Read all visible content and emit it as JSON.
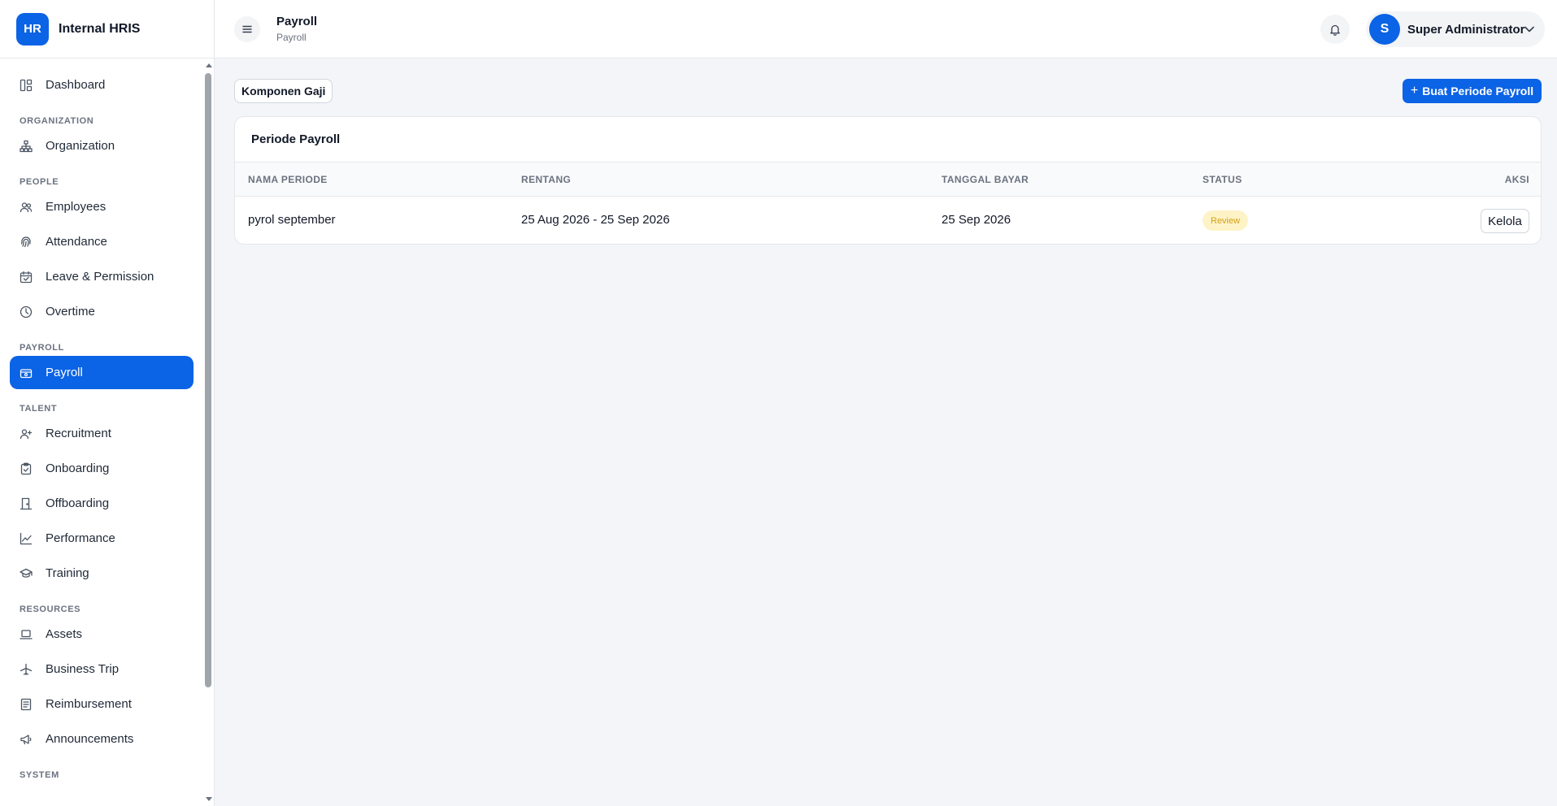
{
  "brand": {
    "logo": "HR",
    "name": "Internal HRIS"
  },
  "sidebar": {
    "items": [
      {
        "type": "item",
        "label": "Dashboard",
        "icon": "dashboard-icon"
      },
      {
        "type": "section",
        "label": "ORGANIZATION"
      },
      {
        "type": "item",
        "label": "Organization",
        "icon": "org-chart-icon"
      },
      {
        "type": "section",
        "label": "PEOPLE"
      },
      {
        "type": "item",
        "label": "Employees",
        "icon": "users-icon"
      },
      {
        "type": "item",
        "label": "Attendance",
        "icon": "fingerprint-icon"
      },
      {
        "type": "item",
        "label": "Leave & Permission",
        "icon": "calendar-check-icon"
      },
      {
        "type": "item",
        "label": "Overtime",
        "icon": "clock-icon"
      },
      {
        "type": "section",
        "label": "PAYROLL"
      },
      {
        "type": "item",
        "label": "Payroll",
        "icon": "wallet-icon",
        "active": true
      },
      {
        "type": "section",
        "label": "TALENT"
      },
      {
        "type": "item",
        "label": "Recruitment",
        "icon": "user-plus-icon"
      },
      {
        "type": "item",
        "label": "Onboarding",
        "icon": "clipboard-icon"
      },
      {
        "type": "item",
        "label": "Offboarding",
        "icon": "door-icon"
      },
      {
        "type": "item",
        "label": "Performance",
        "icon": "trend-icon"
      },
      {
        "type": "item",
        "label": "Training",
        "icon": "graduation-cap-icon"
      },
      {
        "type": "section",
        "label": "RESOURCES"
      },
      {
        "type": "item",
        "label": "Assets",
        "icon": "laptop-icon"
      },
      {
        "type": "item",
        "label": "Business Trip",
        "icon": "plane-icon"
      },
      {
        "type": "item",
        "label": "Reimbursement",
        "icon": "receipt-icon"
      },
      {
        "type": "item",
        "label": "Announcements",
        "icon": "megaphone-icon"
      },
      {
        "type": "section",
        "label": "SYSTEM"
      }
    ]
  },
  "header": {
    "title": "Payroll",
    "subtitle": "Payroll",
    "user": {
      "initial": "S",
      "name": "Super Administrator"
    }
  },
  "toolbar": {
    "components_label": "Komponen Gaji",
    "create_label": "Buat Periode Payroll"
  },
  "table": {
    "title": "Periode Payroll",
    "columns": [
      "NAMA PERIODE",
      "RENTANG",
      "TANGGAL BAYAR",
      "STATUS",
      "AKSI"
    ],
    "rows": [
      {
        "name": "pyrol september",
        "range": "25 Aug 2026 - 25 Sep 2026",
        "pay_date": "25 Sep 2026",
        "status": "Review",
        "action": "Kelola"
      }
    ]
  },
  "colors": {
    "primary": "#0b63e5",
    "status_review_bg": "#fef3c7",
    "status_review_text": "#d4a017"
  }
}
